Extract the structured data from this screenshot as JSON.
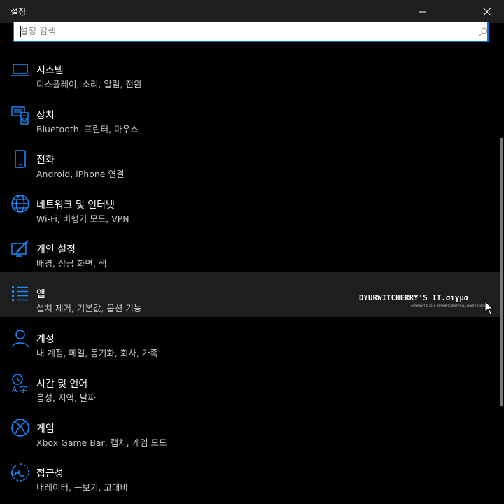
{
  "window": {
    "title": "설정",
    "minimize_icon": "minimize-icon",
    "maximize_icon": "maximize-icon",
    "close_icon": "close-icon"
  },
  "search": {
    "placeholder": "설정 검색",
    "value": "",
    "icon": "search-icon"
  },
  "accent_color": "#0078d7",
  "items": [
    {
      "title": "시스템",
      "subtitle": "디스플레이, 소리, 알림, 전원",
      "icon": "laptop-icon"
    },
    {
      "title": "장치",
      "subtitle": "Bluetooth, 프린터, 마우스",
      "icon": "devices-icon"
    },
    {
      "title": "전화",
      "subtitle": "Android, iPhone 연결",
      "icon": "phone-icon"
    },
    {
      "title": "네트워크 및 인터넷",
      "subtitle": "Wi-Fi, 비행기 모드, VPN",
      "icon": "globe-icon"
    },
    {
      "title": "개인 설정",
      "subtitle": "배경, 잠금 화면, 색",
      "icon": "personalization-icon"
    },
    {
      "title": "앱",
      "subtitle": "설치 제거, 기본값, 옵션 기능",
      "icon": "apps-list-icon"
    },
    {
      "title": "계정",
      "subtitle": "내 계정, 메일, 동기화, 회사, 가족",
      "icon": "person-icon"
    },
    {
      "title": "시간 및 언어",
      "subtitle": "음성, 지역, 날짜",
      "icon": "time-language-icon"
    },
    {
      "title": "게임",
      "subtitle": "Xbox Game Bar, 캡처, 게임 모드",
      "icon": "xbox-icon"
    },
    {
      "title": "접근성",
      "subtitle": "내레이터, 돋보기, 고대비",
      "icon": "accessibility-icon"
    }
  ],
  "watermark": {
    "main": "DYURWITCHERRY'S IT.σῖγμα",
    "sub": "COPYRIGHT © 2019 · DYURWITCHERRY'S ALL RIGHTS RESERVED."
  }
}
